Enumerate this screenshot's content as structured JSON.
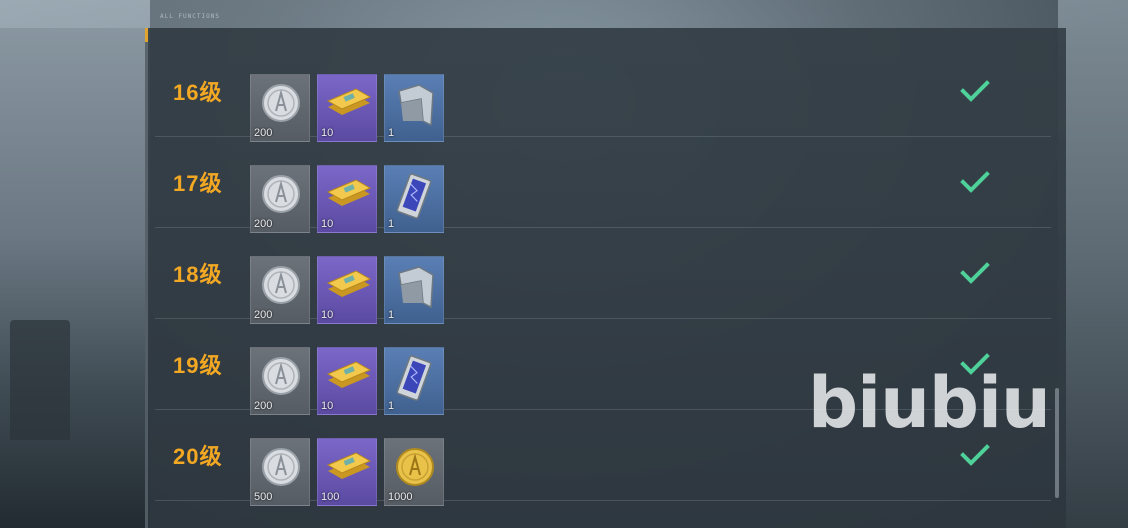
{
  "header": {
    "code_text": "ALL FUNCTIONS"
  },
  "rows": [
    {
      "level": "16级",
      "items": [
        {
          "icon": "silver-coin-icon",
          "count": "200",
          "bg": "gray"
        },
        {
          "icon": "gold-ticket-stack-icon",
          "count": "10",
          "bg": "purple"
        },
        {
          "icon": "armor-plate-icon",
          "count": "1",
          "bg": "blue"
        }
      ],
      "claimed": true
    },
    {
      "level": "17级",
      "items": [
        {
          "icon": "silver-coin-icon",
          "count": "200",
          "bg": "gray"
        },
        {
          "icon": "gold-ticket-stack-icon",
          "count": "10",
          "bg": "purple"
        },
        {
          "icon": "circuit-card-icon",
          "count": "1",
          "bg": "blue"
        }
      ],
      "claimed": true
    },
    {
      "level": "18级",
      "items": [
        {
          "icon": "silver-coin-icon",
          "count": "200",
          "bg": "gray"
        },
        {
          "icon": "gold-ticket-stack-icon",
          "count": "10",
          "bg": "purple"
        },
        {
          "icon": "armor-plate-icon",
          "count": "1",
          "bg": "blue"
        }
      ],
      "claimed": true
    },
    {
      "level": "19级",
      "items": [
        {
          "icon": "silver-coin-icon",
          "count": "200",
          "bg": "gray"
        },
        {
          "icon": "gold-ticket-stack-icon",
          "count": "10",
          "bg": "purple"
        },
        {
          "icon": "circuit-card-icon",
          "count": "1",
          "bg": "blue"
        }
      ],
      "claimed": true
    },
    {
      "level": "20级",
      "items": [
        {
          "icon": "silver-coin-icon",
          "count": "500",
          "bg": "gray"
        },
        {
          "icon": "gold-ticket-stack-icon",
          "count": "100",
          "bg": "purple"
        },
        {
          "icon": "gold-coin-icon",
          "count": "1000",
          "bg": "gray"
        }
      ],
      "claimed": true
    }
  ],
  "watermark": "biubiu",
  "colors": {
    "level_text": "#f3a823",
    "check": "#4fd19a",
    "panel": "#343e46"
  }
}
